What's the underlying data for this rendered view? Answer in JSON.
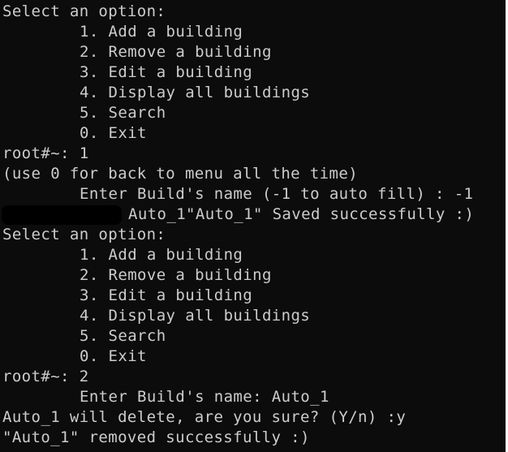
{
  "terminal": {
    "lines": [
      {
        "text": "Select an option:",
        "indent": "none"
      },
      {
        "text": "1. Add a building",
        "indent": "menu"
      },
      {
        "text": "2. Remove a building",
        "indent": "menu"
      },
      {
        "text": "3. Edit a building",
        "indent": "menu"
      },
      {
        "text": "4. Display all buildings",
        "indent": "menu"
      },
      {
        "text": "5. Search",
        "indent": "menu"
      },
      {
        "text": "0. Exit",
        "indent": "menu"
      },
      {
        "text": "root#~: 1",
        "indent": "none"
      },
      {
        "text": "(use 0 for back to menu all the time)",
        "indent": "none"
      },
      {
        "text": "Enter Build's name (-1 to auto fill) : -1",
        "indent": "menu"
      },
      {
        "text": "Auto_1\"Auto_1\" Saved successfully :)",
        "indent": "deep"
      },
      {
        "text": "Select an option:",
        "indent": "none"
      },
      {
        "text": "1. Add a building",
        "indent": "menu"
      },
      {
        "text": "2. Remove a building",
        "indent": "menu"
      },
      {
        "text": "3. Edit a building",
        "indent": "menu"
      },
      {
        "text": "4. Display all buildings",
        "indent": "menu"
      },
      {
        "text": "5. Search",
        "indent": "menu"
      },
      {
        "text": "0. Exit",
        "indent": "menu"
      },
      {
        "text": "root#~: 2",
        "indent": "none"
      },
      {
        "text": "Enter Build's name: Auto_1",
        "indent": "menu"
      },
      {
        "text": "Auto_1 will delete, are you sure? (Y/n) :y",
        "indent": "none"
      },
      {
        "text": "\"Auto_1\" removed successfully :)",
        "indent": "none"
      }
    ],
    "colors": {
      "background": "#0c0c0c",
      "foreground": "#cccccc"
    }
  }
}
